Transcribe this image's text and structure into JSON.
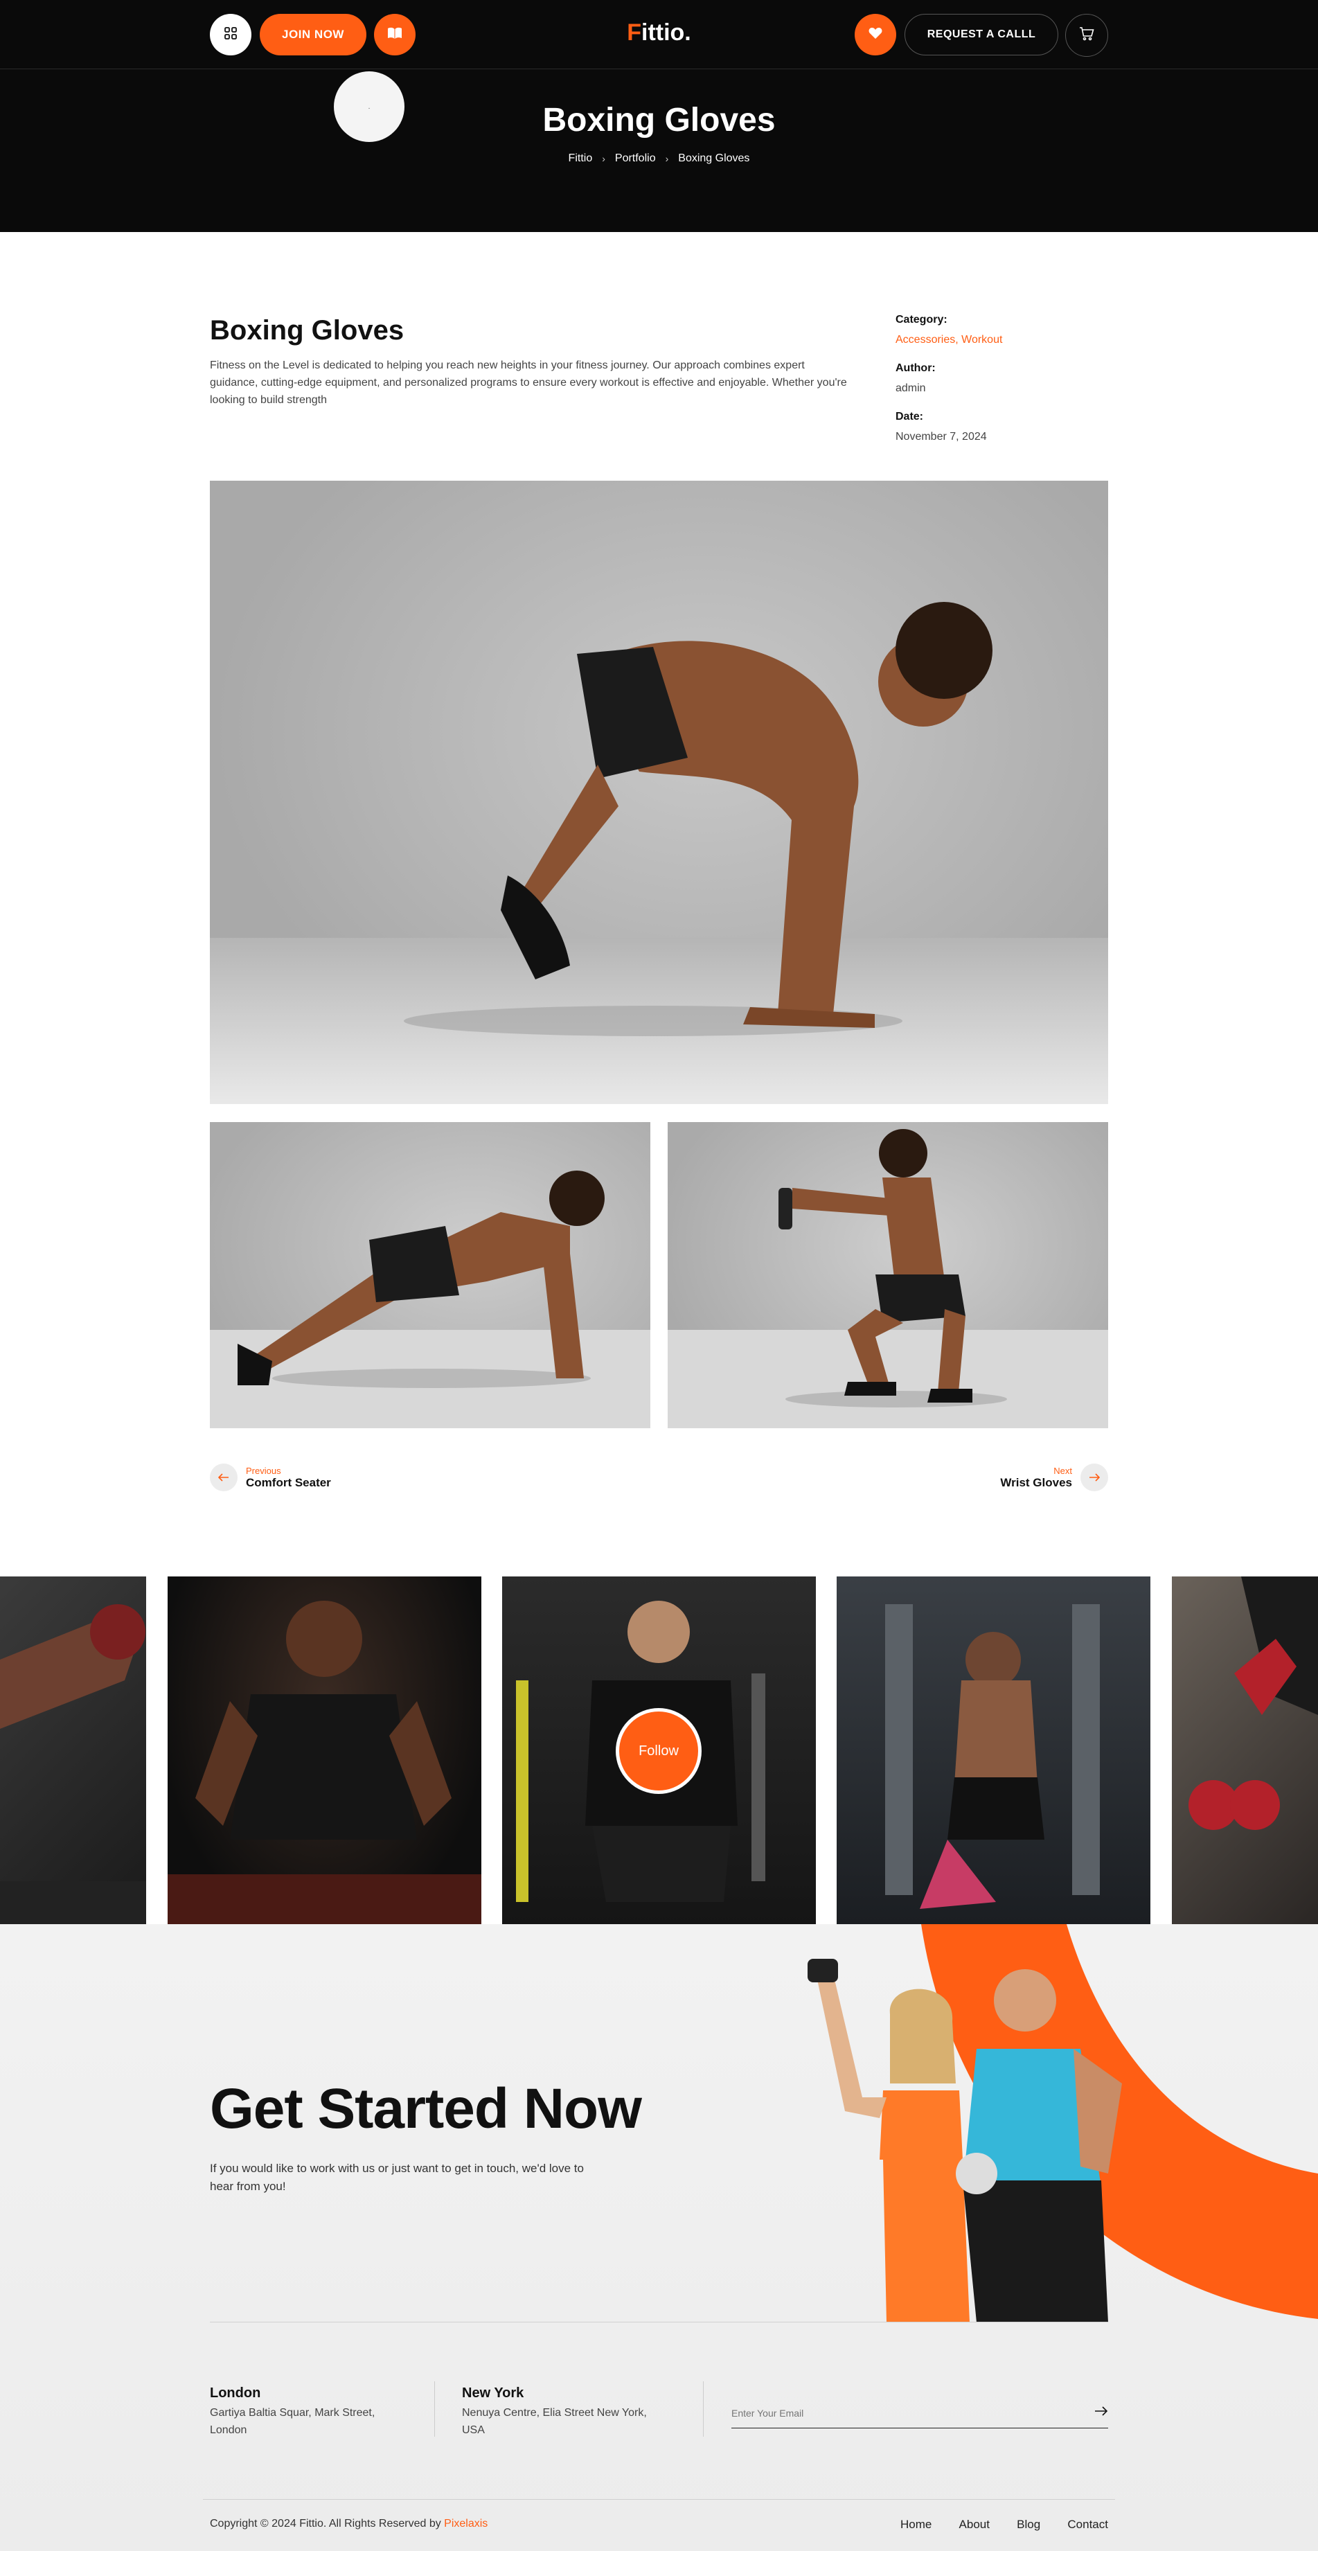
{
  "header": {
    "menu_icon": "grid-icon",
    "join_label": "JOIN NOW",
    "book_icon": "book-open-icon",
    "logo_first": "F",
    "logo_rest": "ittio.",
    "heart_icon": "heart-icon",
    "request_label": "REQUEST A CALLL",
    "cart_icon": "cart-icon",
    "dot": "."
  },
  "hero": {
    "title": "Boxing Gloves",
    "breadcrumb": [
      "Fittio",
      "Portfolio",
      "Boxing Gloves"
    ]
  },
  "project": {
    "title": "Boxing Gloves",
    "description": "Fitness on the Level is dedicated to helping you reach new heights in your fitness journey. Our approach combines expert guidance, cutting-edge equipment, and personalized programs to ensure every workout is effective and enjoyable. Whether you're looking to build strength",
    "meta": {
      "category_label": "Category:",
      "category_value": "Accessories, Workout",
      "author_label": "Author:",
      "author_value": "admin",
      "date_label": "Date:",
      "date_value": "November 7, 2024"
    }
  },
  "post_nav": {
    "prev_small": "Previous",
    "prev_title": "Comfort Seater",
    "next_small": "Next",
    "next_title": "Wrist Gloves"
  },
  "gallery": {
    "follow_label": "Follow"
  },
  "cta": {
    "title": "Get Started Now",
    "text": "If you would like to work with us or just want to get in touch, we'd love to hear from you!"
  },
  "footer": {
    "offices": [
      {
        "city": "London",
        "address": "Gartiya Baltia Squar, Mark Street, London"
      },
      {
        "city": "New York",
        "address": "Nenuya Centre, Elia Street New York, USA"
      }
    ],
    "email_placeholder": "Enter Your Email",
    "copyright_prefix": "Copyright © 2024 Fittio. All Rights Reserved by ",
    "copyright_brand": "Pixelaxis",
    "links": [
      "Home",
      "About",
      "Blog",
      "Contact"
    ]
  },
  "colors": {
    "accent": "#ff5e14",
    "dark": "#0a0a0a"
  }
}
